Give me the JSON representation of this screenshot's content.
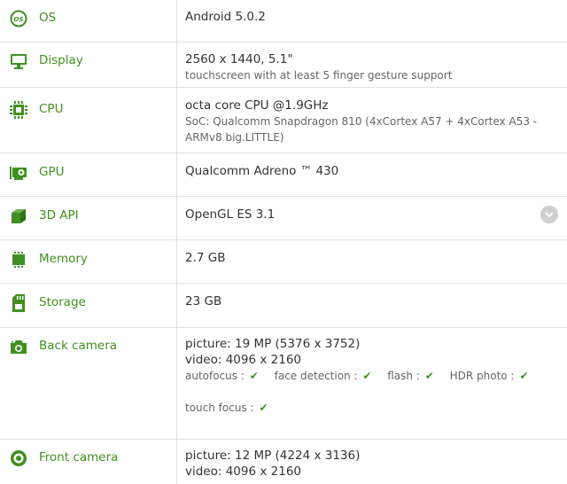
{
  "rows": [
    {
      "label": "OS",
      "icon": "os-icon",
      "value": "Android 5.0.2"
    },
    {
      "label": "Display",
      "icon": "display-icon",
      "value": "2560 x 1440, 5.1\"",
      "sub": "touchscreen with at least 5 finger gesture support"
    },
    {
      "label": "CPU",
      "icon": "cpu-icon",
      "value": "octa core CPU @1.9GHz",
      "sub": "SoC: Qualcomm Snapdragon 810 (4xCortex A57 + 4xCortex A53 - ARMv8 big.LITTLE)"
    },
    {
      "label": "GPU",
      "icon": "gpu-icon",
      "value": "Qualcomm Adreno ™ 430"
    },
    {
      "label": "3D API",
      "icon": "cube-icon",
      "value": "OpenGL ES 3.1"
    },
    {
      "label": "Memory",
      "icon": "memory-icon",
      "value": "2.7 GB"
    },
    {
      "label": "Storage",
      "icon": "storage-icon",
      "value": "23 GB"
    },
    {
      "label": "Back camera",
      "icon": "camera-icon",
      "picture": "picture: 19 MP (5376 x 3752)",
      "video": "video: 4096 x 2160",
      "features": {
        "autofocus": "autofocus :",
        "face": "face detection :",
        "flash": "flash :",
        "hdr": "HDR photo :",
        "touch": "touch focus :"
      }
    },
    {
      "label": "Front camera",
      "icon": "front-camera-icon",
      "picture": "picture: 12 MP (4224 x 3136)",
      "video": "video: 4096 x 2160"
    }
  ],
  "colors": {
    "accent": "#3f9020",
    "border": "#e2e2e2"
  }
}
